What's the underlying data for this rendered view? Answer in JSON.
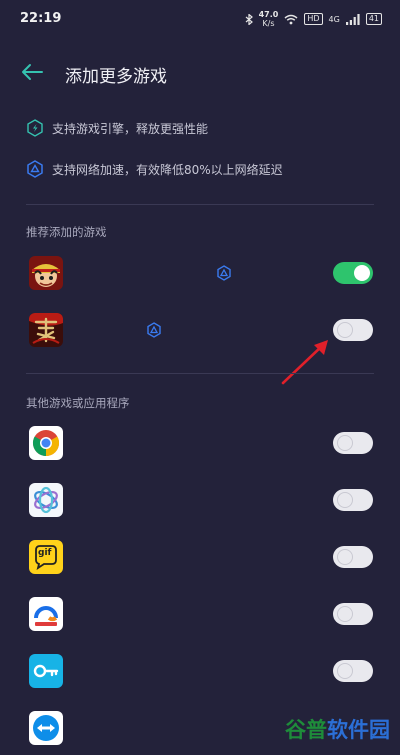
{
  "status_bar": {
    "time": "22:19",
    "speed_value": "47.0",
    "speed_unit": "K/s",
    "network_badge": "HD",
    "signal": "4G",
    "battery": "41"
  },
  "header": {
    "title": "添加更多游戏"
  },
  "features": [
    {
      "icon": "engine-icon",
      "text": "支持游戏引擎，释放更强性能"
    },
    {
      "icon": "network-accel-icon",
      "text": "支持网络加速，有效降低80%以上网络延迟"
    }
  ],
  "recommended": {
    "title": "推荐添加的游戏",
    "apps": [
      {
        "icon": "one-piece-game-icon",
        "enabled": true,
        "accel": true
      },
      {
        "icon": "martial-arts-game-icon",
        "enabled": false,
        "accel": true
      }
    ]
  },
  "others": {
    "title": "其他游戏或应用程序",
    "apps": [
      {
        "icon": "chrome-icon",
        "enabled": false
      },
      {
        "icon": "knot-app-icon",
        "enabled": false
      },
      {
        "icon": "gif-app-icon",
        "enabled": false,
        "label": "gif"
      },
      {
        "icon": "browser-app-icon",
        "enabled": false
      },
      {
        "icon": "key-app-icon",
        "enabled": false
      },
      {
        "icon": "teamviewer-icon",
        "enabled": false
      }
    ]
  },
  "colors": {
    "background": "#23223a",
    "toggle_on": "#2ec46d",
    "accent_teal": "#35c2b0",
    "accel_blue": "#3a7bf0",
    "arrow_red": "#e0202a"
  },
  "watermark": {
    "part1": "谷普",
    "part2": "软件园"
  }
}
